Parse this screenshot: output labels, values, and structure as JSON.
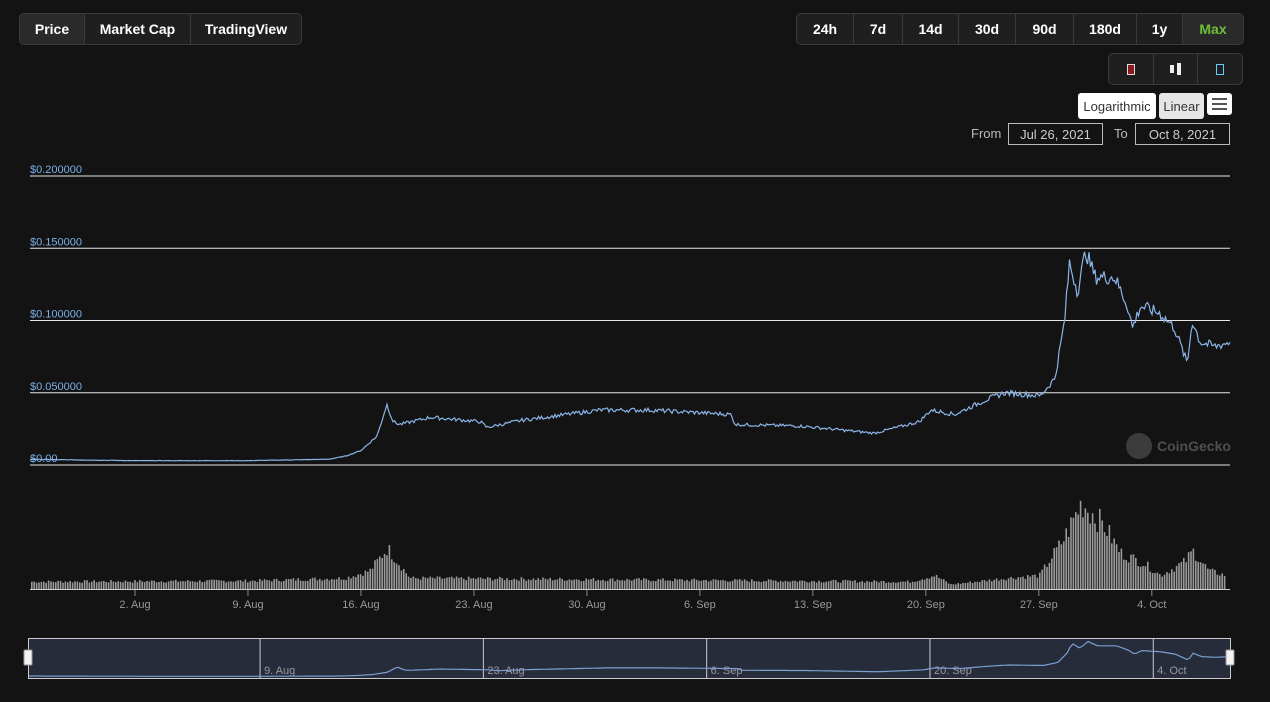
{
  "tabs": [
    {
      "label": "Price",
      "active": true
    },
    {
      "label": "Market Cap"
    },
    {
      "label": "TradingView"
    }
  ],
  "ranges": [
    {
      "label": "24h"
    },
    {
      "label": "7d"
    },
    {
      "label": "14d"
    },
    {
      "label": "30d"
    },
    {
      "label": "90d"
    },
    {
      "label": "180d"
    },
    {
      "label": "1y"
    },
    {
      "label": "Max",
      "active": true
    }
  ],
  "chart_types": [
    "line-chart-icon",
    "candlestick-icon",
    "ohlc-icon"
  ],
  "scale": {
    "log": "Logarithmic",
    "linear": "Linear"
  },
  "menu_icon": "hamburger-menu-icon",
  "date_range": {
    "from_label": "From",
    "from": "Jul 26, 2021",
    "to_label": "To",
    "to": "Oct 8, 2021"
  },
  "watermark": "CoinGecko",
  "colors": {
    "line": "#8ab4e8",
    "volume": "#9a9a9a",
    "accent": "#6fbf3a"
  },
  "chart_data": {
    "type": "line",
    "y_ticks": [
      "$0.00",
      "$0.050000",
      "$0.100000",
      "$0.150000",
      "$0.200000"
    ],
    "y_tick_values": [
      0,
      0.05,
      0.1,
      0.15,
      0.2
    ],
    "ylim": [
      0,
      0.2
    ],
    "x_ticks": [
      "2. Aug",
      "9. Aug",
      "16. Aug",
      "23. Aug",
      "30. Aug",
      "6. Sep",
      "13. Sep",
      "20. Sep",
      "27. Sep",
      "4. Oct"
    ],
    "x_tick_days": [
      7,
      14,
      21,
      28,
      35,
      42,
      49,
      56,
      63,
      70
    ],
    "x_note": "days since Jul 26, 2021",
    "price": [
      [
        0,
        0.004
      ],
      [
        7,
        0.003
      ],
      [
        14,
        0.003
      ],
      [
        19,
        0.004
      ],
      [
        20,
        0.006
      ],
      [
        21,
        0.01
      ],
      [
        22,
        0.02
      ],
      [
        22.6,
        0.042
      ],
      [
        23,
        0.03
      ],
      [
        23.4,
        0.028
      ],
      [
        25.3,
        0.033
      ],
      [
        28.4,
        0.03
      ],
      [
        28.8,
        0.026
      ],
      [
        31,
        0.031
      ],
      [
        35.8,
        0.038
      ],
      [
        38.9,
        0.038
      ],
      [
        43.9,
        0.035
      ],
      [
        44.2,
        0.028
      ],
      [
        48.2,
        0.027
      ],
      [
        52.8,
        0.022
      ],
      [
        55.6,
        0.03
      ],
      [
        56.3,
        0.038
      ],
      [
        57.8,
        0.035
      ],
      [
        59.7,
        0.045
      ],
      [
        60.9,
        0.05
      ],
      [
        63.1,
        0.048
      ],
      [
        64,
        0.06
      ],
      [
        64.3,
        0.08
      ],
      [
        64.6,
        0.1
      ],
      [
        64.9,
        0.14
      ],
      [
        65.4,
        0.12
      ],
      [
        65.9,
        0.148
      ],
      [
        66.5,
        0.13
      ],
      [
        67.7,
        0.13
      ],
      [
        68.5,
        0.11
      ],
      [
        68.8,
        0.095
      ],
      [
        69.3,
        0.11
      ],
      [
        70.5,
        0.105
      ],
      [
        71.4,
        0.095
      ],
      [
        72.2,
        0.07
      ],
      [
        72.5,
        0.1
      ],
      [
        73,
        0.085
      ],
      [
        73.9,
        0.082
      ],
      [
        74.8,
        0.085
      ]
    ],
    "volume_relative": [
      [
        0,
        8
      ],
      [
        14,
        9
      ],
      [
        20,
        12
      ],
      [
        21.5,
        20
      ],
      [
        22.6,
        45
      ],
      [
        24,
        12
      ],
      [
        40,
        10
      ],
      [
        55,
        8
      ],
      [
        56.5,
        15
      ],
      [
        57.5,
        5
      ],
      [
        61,
        12
      ],
      [
        63,
        15
      ],
      [
        64.5,
        55
      ],
      [
        65.6,
        95
      ],
      [
        67,
        70
      ],
      [
        68,
        40
      ],
      [
        69.5,
        28
      ],
      [
        70.5,
        15
      ],
      [
        72,
        30
      ],
      [
        72.5,
        42
      ],
      [
        73.5,
        20
      ],
      [
        74.8,
        14
      ]
    ],
    "navigator_ticks": [
      "9. Aug",
      "23. Aug",
      "6. Sep",
      "20. Sep",
      "4. Oct"
    ],
    "navigator_tick_days": [
      14,
      28,
      42,
      56,
      70
    ]
  }
}
